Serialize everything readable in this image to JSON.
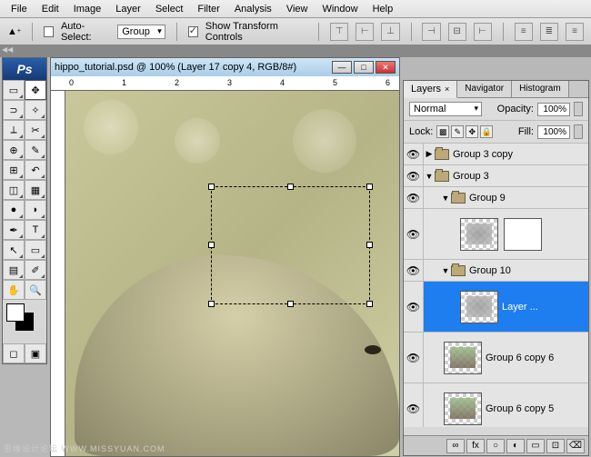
{
  "menu": {
    "items": [
      "File",
      "Edit",
      "Image",
      "Layer",
      "Select",
      "Filter",
      "Analysis",
      "View",
      "Window",
      "Help"
    ]
  },
  "options": {
    "auto_select_label": "Auto-Select:",
    "auto_select_value": "Group",
    "show_transform_label": "Show Transform Controls"
  },
  "document": {
    "title": "hippo_tutorial.psd @ 100% (Layer 17 copy 4, RGB/8#)",
    "ruler_marks": [
      "0",
      "1",
      "2",
      "3",
      "4",
      "5",
      "6"
    ]
  },
  "panels": {
    "tabs": [
      "Layers",
      "Navigator",
      "Histogram"
    ],
    "blend_mode": "Normal",
    "opacity_label": "Opacity:",
    "opacity_value": "100%",
    "lock_label": "Lock:",
    "fill_label": "Fill:",
    "fill_value": "100%"
  },
  "layers": [
    {
      "type": "group",
      "name": "Group 3 copy",
      "visible": true,
      "expanded": false,
      "indent": 0
    },
    {
      "type": "group",
      "name": "Group 3",
      "visible": true,
      "expanded": true,
      "indent": 0
    },
    {
      "type": "group",
      "name": "Group 9",
      "visible": true,
      "expanded": true,
      "indent": 1
    },
    {
      "type": "layer",
      "name": "",
      "visible": true,
      "indent": 2,
      "has_mask": true
    },
    {
      "type": "group",
      "name": "Group 10",
      "visible": true,
      "expanded": true,
      "indent": 1
    },
    {
      "type": "layer",
      "name": "Layer ...",
      "visible": true,
      "indent": 2,
      "selected": true
    },
    {
      "type": "layer",
      "name": "Group 6 copy 6",
      "visible": true,
      "indent": 1
    },
    {
      "type": "layer",
      "name": "Group 6 copy 5",
      "visible": true,
      "indent": 1
    }
  ],
  "footer": {
    "icons": [
      "∞",
      "fx",
      "○",
      "◐",
      "▭",
      "⊡",
      "⌫"
    ]
  },
  "watermark": "思缘设计论坛  WWW.MISSYUAN.COM"
}
